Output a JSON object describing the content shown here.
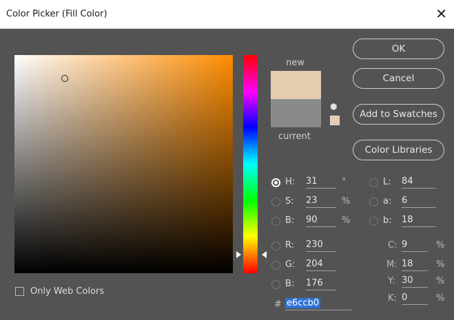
{
  "window": {
    "title": "Color Picker (Fill Color)",
    "close_glyph": "✕"
  },
  "preview": {
    "new_label": "new",
    "current_label": "current",
    "new_color": "#e6ccb0",
    "current_color": "#8a8a8a"
  },
  "buttons": {
    "ok": "OK",
    "cancel": "Cancel",
    "add": "Add to Swatches",
    "libs": "Color Libraries"
  },
  "fields": {
    "h": {
      "label": "H:",
      "value": "31",
      "unit": "°",
      "selected": true
    },
    "s": {
      "label": "S:",
      "value": "23",
      "unit": "%"
    },
    "b": {
      "label": "B:",
      "value": "90",
      "unit": "%"
    },
    "r": {
      "label": "R:",
      "value": "230"
    },
    "g": {
      "label": "G:",
      "value": "204"
    },
    "b2": {
      "label": "B:",
      "value": "176"
    },
    "l": {
      "label": "L:",
      "value": "84"
    },
    "a": {
      "label": "a:",
      "value": "6"
    },
    "bb": {
      "label": "b:",
      "value": "18"
    },
    "c": {
      "label": "C:",
      "value": "9",
      "unit": "%"
    },
    "m": {
      "label": "M:",
      "value": "18",
      "unit": "%"
    },
    "y": {
      "label": "Y:",
      "value": "30",
      "unit": "%"
    },
    "k": {
      "label": "K:",
      "value": "0",
      "unit": "%"
    }
  },
  "hex": {
    "prefix": "#",
    "value": "e6ccb0"
  },
  "only_web": "Only Web Colors",
  "icons": {
    "cube": "cube-icon",
    "websafe": "websafe-swatch-icon"
  }
}
